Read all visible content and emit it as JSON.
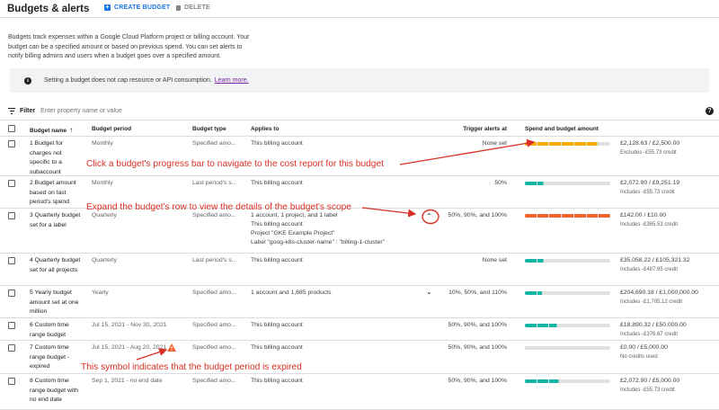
{
  "header": {
    "title": "Budgets & alerts",
    "create_label": "CREATE BUDGET",
    "delete_label": "DELETE"
  },
  "intro_text": "Budgets track expenses within a Google Cloud Platform project or billing account. Your budget can be a specified amount or based on previous spend. You can set alerts to notify billing admins and users when a budget goes over a specified amount.",
  "notice": {
    "text": "Setting a budget does not cap resource or API consumption.",
    "link": "Learn more."
  },
  "filter": {
    "label": "Filter",
    "placeholder": "Enter property name or value"
  },
  "columns": {
    "name": "Budget name",
    "period": "Budget period",
    "type": "Budget type",
    "applies": "Applies to",
    "trigger": "Trigger alerts at",
    "spend": "Spend and budget amount"
  },
  "rows": [
    {
      "name": "1 Budget for charges not specific to a subaccount",
      "period": "Monthly",
      "type": "Specified amo...",
      "applies": "This billing account",
      "trigger": "None set",
      "spend_fraction": 0.85,
      "bar_color": "#f9ab00",
      "amount": "£2,128.63 / £2,500.00",
      "credit": "Excludes -£55.73 credit"
    },
    {
      "name": "2 Budget amount based on last period's spend",
      "period": "Monthly",
      "type": "Last period's s...",
      "applies": "This billing account",
      "trigger": "50%",
      "spend_fraction": 0.22,
      "bar_color": "#12b5a5",
      "amount": "£2,072.90 / £9,251.19",
      "credit": "Includes -£55.73 credit"
    },
    {
      "name": "3 Quarterly budget set for a label",
      "period": "Quarterly",
      "type": "Specified amo...",
      "applies": "1 account, 1 project, and 1 label",
      "applies_lines": [
        "This billing account",
        "Project \"GKE Example Project\"",
        "Label \"goog-k8s-cluster-name\" : \"billing-1-cluster\""
      ],
      "trigger": "50%, 90%, and 100%",
      "spend_fraction": 1.0,
      "bar_color": "#f4622d",
      "amount": "£142.00 / £10.00",
      "credit": "Includes -£365.53 credit"
    },
    {
      "name": "4 Quarterly budget set for all projects",
      "period": "Quarterly",
      "type": "Last period's s...",
      "applies": "This billing account",
      "trigger": "None set",
      "spend_fraction": 0.22,
      "bar_color": "#12b5a5",
      "amount": "£35,058.22 / £105,321.32",
      "credit": "Includes -£487.95 credit"
    },
    {
      "name": "5 Yearly budget amount set at one million",
      "period": "Yearly",
      "type": "Specified amo...",
      "applies": "1 account and 1,685 products",
      "trigger": "10%, 50%, and 110%",
      "spend_fraction": 0.2,
      "bar_color": "#12b5a5",
      "amount": "£204,690.18 / £1,000,000.00",
      "credit": "Includes -£1,705.12 credit"
    },
    {
      "name": "6 Custom time range budget",
      "period": "Jul 15, 2021 - Nov 30, 2021",
      "type": "Specified amo...",
      "applies": "This billing account",
      "trigger": "50%, 90%, and 100%",
      "spend_fraction": 0.38,
      "bar_color": "#12b5a5",
      "amount": "£18,890.32 / £50,000.00",
      "credit": "Includes -£376.67 credit"
    },
    {
      "name": "7 Custom time range budget - expired",
      "period": "Jul 15, 2021 - Aug 20, 2021",
      "type": "Specified amo...",
      "applies": "This billing account",
      "trigger": "50%, 90%, and 100%",
      "spend_fraction": 0.0,
      "bar_color": "#12b5a5",
      "amount": "£0.00 / £5,000.00",
      "credit": "No credits used"
    },
    {
      "name": "8 Custom time range budget with no end date",
      "period": "Sep 1, 2021 - no end date",
      "type": "Specified amo...",
      "applies": "This billing account",
      "trigger": "50%, 90%, and 100%",
      "spend_fraction": 0.4,
      "bar_color": "#12b5a5",
      "amount": "£2,072.90 / £5,000.00",
      "credit": "Includes -£55.73 credit"
    }
  ],
  "annotations": {
    "progress": "Click a budget's progress bar to navigate to the cost report for this budget",
    "expand": "Expand the budget's row to view the details of the budget's scope",
    "expired": "This symbol indicates that the budget period is expired"
  },
  "colors": {
    "annotation": "#d93025",
    "accent": "#1a73e8"
  }
}
